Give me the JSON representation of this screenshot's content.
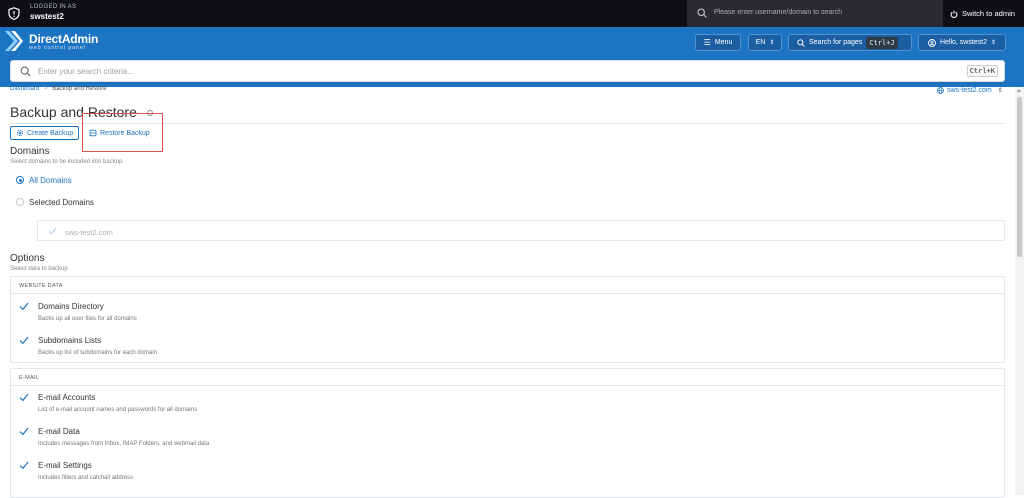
{
  "topbar": {
    "logged_in_as": "LOGGED IN AS",
    "username": "swstest2",
    "search_placeholder": "Please enter username/domain to search",
    "switch_label": "Switch to admin"
  },
  "header": {
    "brand_title": "DirectAdmin",
    "brand_subtitle": "web control panel",
    "menu_label": "Menu",
    "language": "EN",
    "search_pages_label": "Search for pages",
    "search_pages_shortcut": "Ctrl+J",
    "hello_label": "Hello, swstest2"
  },
  "searchbar": {
    "placeholder": "Enter your search criteria...",
    "shortcut": "Ctrl+K"
  },
  "breadcrumb": {
    "home": "Dashboard",
    "separator": ">",
    "current": "Backup and Restore"
  },
  "domain_selector": "sws-test2.com",
  "page": {
    "title": "Backup and Restore",
    "tabs": [
      {
        "label": "Create Backup"
      },
      {
        "label": "Restore Backup"
      }
    ]
  },
  "domains": {
    "title": "Domains",
    "subtitle": "Select domains to be included into backup",
    "all_label": "All Domains",
    "selected_label": "Selected Domains",
    "selected_option": "all",
    "domain_list": [
      "sws-test2.com"
    ]
  },
  "options": {
    "title": "Options",
    "subtitle": "Select data to backup",
    "groups": [
      {
        "heading": "WEBSITE DATA",
        "items": [
          {
            "title": "Domains Directory",
            "desc": "Backs up all user files for all domains",
            "checked": true
          },
          {
            "title": "Subdomains Lists",
            "desc": "Backs up list of subdomains for each domain",
            "checked": true
          }
        ]
      },
      {
        "heading": "E-MAIL",
        "items": [
          {
            "title": "E-mail Accounts",
            "desc": "List of e-mail account names and passwords for all domains",
            "checked": true
          },
          {
            "title": "E-mail Data",
            "desc": "Includes messages from Inbox, IMAP Folders, and webmail data",
            "checked": true
          },
          {
            "title": "E-mail Settings",
            "desc": "Includes filters and catchall address",
            "checked": true
          }
        ]
      }
    ]
  },
  "colors": {
    "accent": "#1d74c2",
    "topbar": "#0d0f14",
    "highlight": "#d9534f"
  }
}
